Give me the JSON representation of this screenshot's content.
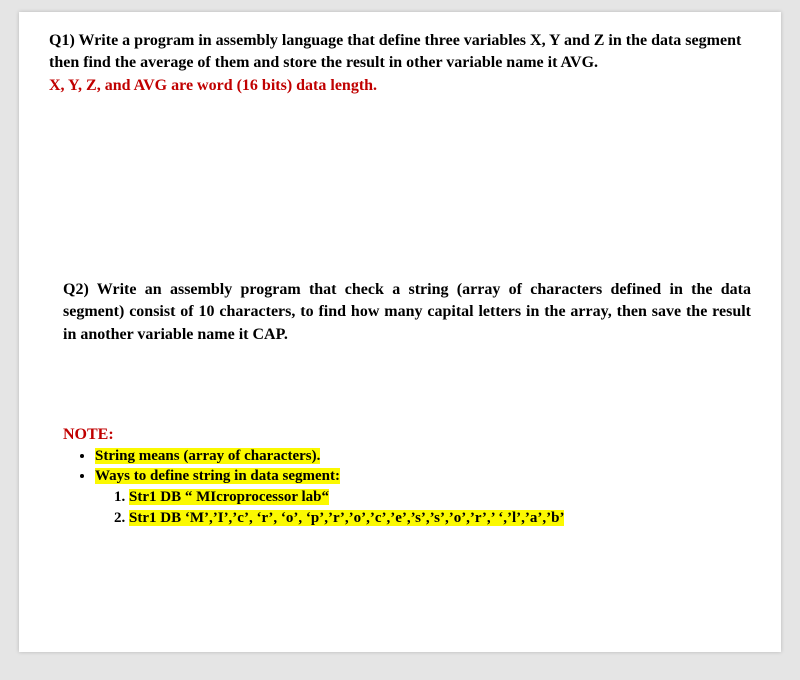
{
  "q1": {
    "text_black": "Q1) Write a program in assembly language that define three variables X, Y and Z in the data segment then find the average of them and store the result in other variable name it AVG.",
    "text_red": "X, Y, Z, and AVG are word (16 bits) data length."
  },
  "q2": {
    "text": "Q2) Write an assembly program that check a string (array of characters defined in the data segment) consist of 10 characters, to find how many capital letters in the array, then save the result in another variable name it CAP."
  },
  "note": {
    "title": "NOTE:",
    "b1": "String means (array of characters).",
    "b2": "Ways to define string in data segment:",
    "n1": "Str1 DB “ MIcroprocessor lab“",
    "n2": "Str1 DB ‘M’,’I’,’c’, ‘r’, ‘o’, ‘p’,’r’,’o’,’c’,’e’,’s’,’s’,’o’,’r’,’ ‘,’l’,’a’,’b’"
  }
}
